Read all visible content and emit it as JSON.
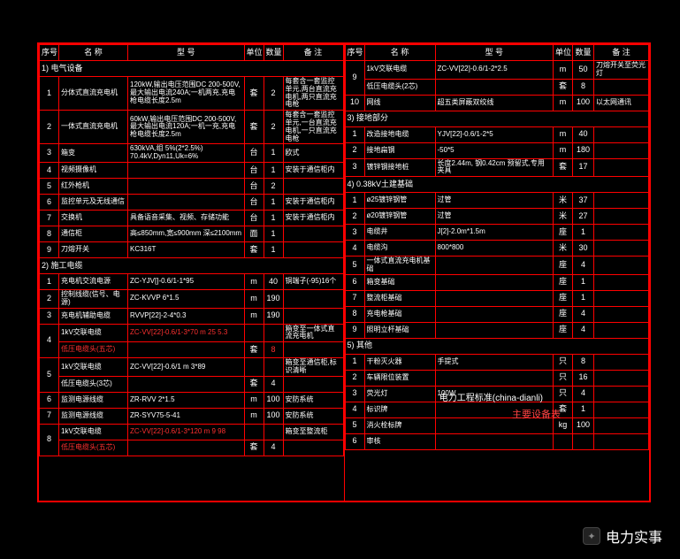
{
  "headers": [
    "序号",
    "名 称",
    "型  号",
    "单位",
    "数量",
    "备 注"
  ],
  "left": {
    "sec1": "1) 电气设备",
    "rows1": [
      {
        "n": "1",
        "name": "分体式直流充电机",
        "model": "120kW,输出电压范围DC 200-500V,最大输出电流240A;一机两充,充电枪电缆长度2.5m",
        "u": "套",
        "q": "2",
        "note": "每套含一套监控单元,两台直流充电机,两只直流充电枪"
      },
      {
        "n": "2",
        "name": "一体式直流充电机",
        "model": "60kW,输出电压范围DC 200-500V,最大输出电流120A;一机一充,充电枪电缆长度2.5m",
        "u": "套",
        "q": "2",
        "note": "每套含一套监控单元,一台直流充电机,一只直流充电枪"
      },
      {
        "n": "3",
        "name": "箱变",
        "model": "630kVA,组 5%(2*2.5%) 70.4kV,Dyn11,Uk=6%",
        "u": "台",
        "q": "1",
        "note": "欧式"
      },
      {
        "n": "4",
        "name": "视频摄像机",
        "model": "",
        "u": "台",
        "q": "1",
        "note": "安装于通信柜内"
      },
      {
        "n": "5",
        "name": "红外枪机",
        "model": "",
        "u": "台",
        "q": "2",
        "note": ""
      },
      {
        "n": "6",
        "name": "监控单元及无线通信",
        "model": "",
        "u": "台",
        "q": "1",
        "note": "安装于通信柜内"
      },
      {
        "n": "7",
        "name": "交换机",
        "model": "具备语音采集、视频、存储功能",
        "u": "台",
        "q": "1",
        "note": "安装于通信柜内"
      },
      {
        "n": "8",
        "name": "通信柜",
        "model": "高≤850mm,宽≤900mm 深≤2100mm",
        "u": "面",
        "q": "1",
        "note": ""
      },
      {
        "n": "9",
        "name": "刀熔开关",
        "model": "KC316T",
        "u": "套",
        "q": "1",
        "note": ""
      }
    ],
    "sec2": "2) 施工电缆",
    "rows2": [
      {
        "n": "1",
        "name": "充电机交流电源",
        "model": "ZC-YJV[]-0.6/1-1*95",
        "u": "m",
        "q": "40",
        "note": "铜端子(-95)16个"
      },
      {
        "n": "2",
        "name": "控制线缆(信号、电源)",
        "model": "ZC-KVVP 6*1.5",
        "u": "m",
        "q": "190",
        "note": ""
      },
      {
        "n": "3",
        "name": "充电机辅助电缆",
        "model": "RVVP[22]-2-4*0.3",
        "u": "m",
        "q": "190",
        "note": ""
      },
      {
        "n": "4a",
        "name": "1kV交联电缆",
        "model": "ZC-VV[22]-0.6/1-3*70 m 25 5.3",
        "u": "",
        "q": "",
        "note": "箱变至一体式直流充电机",
        "red": [
          "model"
        ]
      },
      {
        "n": "4b",
        "name": "低压电缆头(五芯)",
        "model": "",
        "u": "套",
        "q": "8",
        "note": "",
        "red": [
          "name",
          "q"
        ]
      },
      {
        "n": "5a",
        "name": "1kV交联电缆",
        "model": "ZC-VV[22]-0.6/1 m 3*89",
        "u": "",
        "q": "",
        "note": "箱变至通信柜,标识清晰"
      },
      {
        "n": "5b",
        "name": "低压电缆头(3芯)",
        "model": "",
        "u": "套",
        "q": "4",
        "note": ""
      },
      {
        "n": "6",
        "name": "监测电源线缆",
        "model": "ZR-RVV 2*1.5",
        "u": "m",
        "q": "100",
        "note": "安防系统"
      },
      {
        "n": "7",
        "name": "监测电源线缆",
        "model": "ZR-SYV75-5-41",
        "u": "m",
        "q": "100",
        "note": "安防系统"
      },
      {
        "n": "8a",
        "name": "1kV交联电缆",
        "model": "ZC-VV[22]-0.6/1-3*120 m 9 98",
        "u": "",
        "q": "",
        "note": "箱变至整流柜",
        "red": [
          "model",
          "q"
        ]
      },
      {
        "n": "8b",
        "name": "低压电缆头(五芯)",
        "model": "",
        "u": "套",
        "q": "4",
        "note": "",
        "red": [
          "name"
        ]
      }
    ]
  },
  "right": {
    "rows_top": [
      {
        "n": "9a",
        "name": "1kV交联电缆",
        "model": "ZC-VV[22]-0.6/1-2*2.5",
        "u": "m",
        "q": "50",
        "note": "刀熔开关至荧光灯"
      },
      {
        "n": "9b",
        "name": "低压电缆头(2芯)",
        "model": "",
        "u": "套",
        "q": "8",
        "note": ""
      },
      {
        "n": "10",
        "name": "网线",
        "model": "超五类屏蔽双绞线",
        "u": "m",
        "q": "100",
        "note": "以太网通讯"
      }
    ],
    "sec3": "3) 接地部分",
    "rows3": [
      {
        "n": "1",
        "name": "改造接地电缆",
        "model": "YJV[22]-0.6/1-2*5",
        "u": "m",
        "q": "40",
        "note": ""
      },
      {
        "n": "2",
        "name": "接地扁钢",
        "model": "-50*5",
        "u": "m",
        "q": "180",
        "note": ""
      },
      {
        "n": "3",
        "name": "镀锌钢接地桩",
        "model": "长度2.44m, 钢0.42cm 预留式,专用夹具",
        "u": "套",
        "q": "17",
        "note": ""
      }
    ],
    "sec4": "4) 0.38kV土建基础",
    "rows4": [
      {
        "n": "1",
        "name": "ø25镀锌钢管",
        "model": "过管",
        "u": "米",
        "q": "37",
        "note": ""
      },
      {
        "n": "2",
        "name": "ø20镀锌钢管",
        "model": "过管",
        "u": "米",
        "q": "27",
        "note": ""
      },
      {
        "n": "3",
        "name": "电缆井",
        "model": "J[2]-2.0m*1.5m",
        "u": "座",
        "q": "1",
        "note": ""
      },
      {
        "n": "4",
        "name": "电缆沟",
        "model": "800*800",
        "u": "米",
        "q": "30",
        "note": ""
      },
      {
        "n": "5",
        "name": "一体式直流充电机基础",
        "model": "",
        "u": "座",
        "q": "4",
        "note": ""
      },
      {
        "n": "6",
        "name": "箱变基础",
        "model": "",
        "u": "座",
        "q": "1",
        "note": ""
      },
      {
        "n": "7",
        "name": "整流柜基础",
        "model": "",
        "u": "座",
        "q": "1",
        "note": ""
      },
      {
        "n": "8",
        "name": "充电枪基础",
        "model": "",
        "u": "座",
        "q": "4",
        "note": ""
      },
      {
        "n": "9",
        "name": "照明立杆基础",
        "model": "",
        "u": "座",
        "q": "4",
        "note": ""
      }
    ],
    "sec5": "5) 其他",
    "rows5": [
      {
        "n": "1",
        "name": "干粉灭火器",
        "model": "手提式",
        "u": "只",
        "q": "8",
        "note": ""
      },
      {
        "n": "2",
        "name": "车辆限位装置",
        "model": "",
        "u": "只",
        "q": "16",
        "note": ""
      },
      {
        "n": "3",
        "name": "荧光灯",
        "model": "100W",
        "u": "只",
        "q": "4",
        "note": ""
      },
      {
        "n": "4",
        "name": "标识牌",
        "model": "",
        "u": "套",
        "q": "1",
        "note": ""
      },
      {
        "n": "5",
        "name": "消火栓标牌",
        "model": "",
        "u": "kg",
        "q": "100",
        "note": ""
      },
      {
        "n": "6",
        "name": "审核",
        "model": "",
        "u": "",
        "q": "",
        "note": ""
      }
    ]
  },
  "footer_site": "电力工程标准(china-dianli)",
  "footer_red": "主要设备表",
  "watermark": "电力实事"
}
